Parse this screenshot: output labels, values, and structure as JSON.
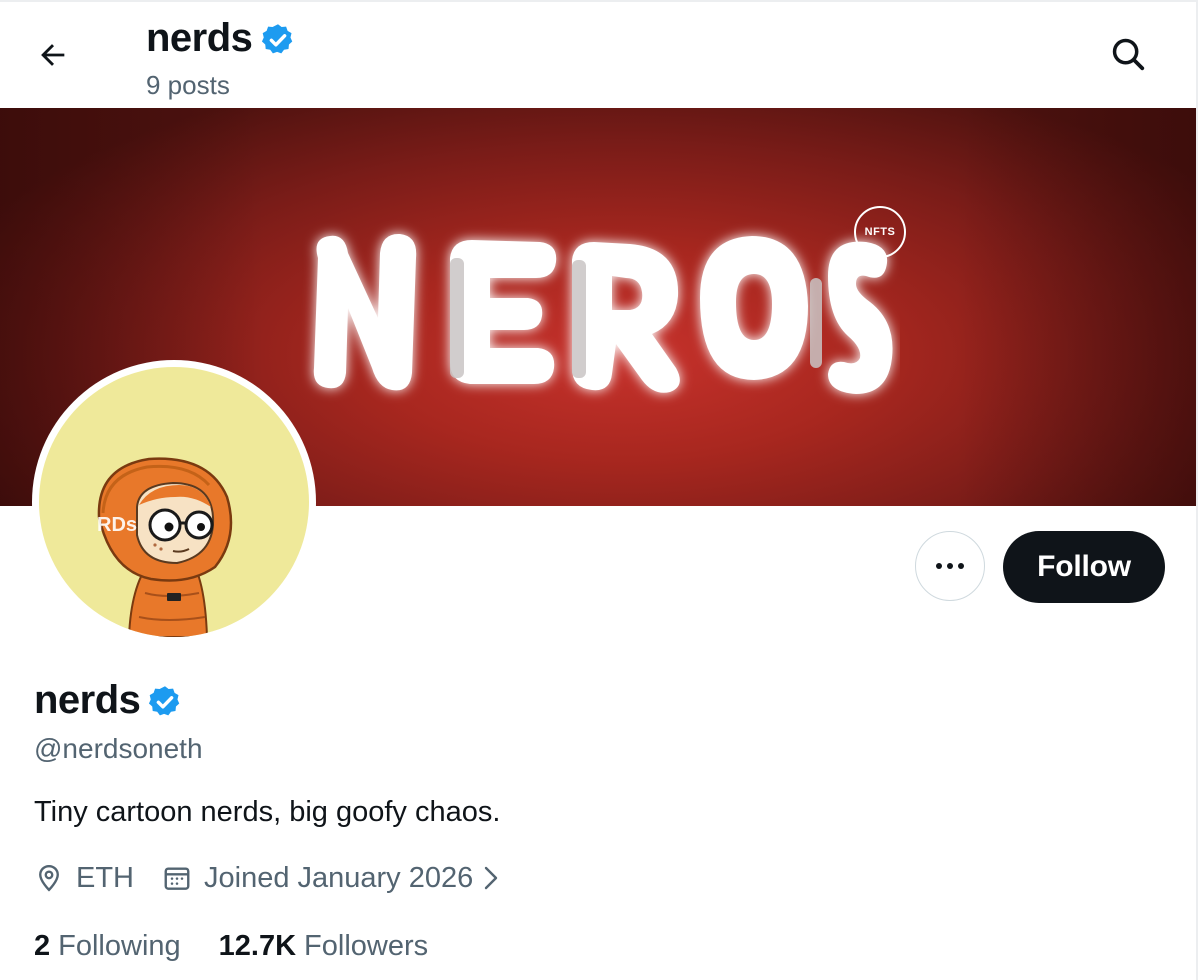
{
  "header": {
    "title": "nerds",
    "posts_count": "9 posts"
  },
  "banner": {
    "logo_text": "NERDS",
    "badge_text": "NFTS"
  },
  "avatar": {
    "hood_text": "RDs"
  },
  "actions": {
    "follow_label": "Follow"
  },
  "profile": {
    "display_name": "nerds",
    "handle": "@nerdsoneth",
    "bio": "Tiny cartoon nerds, big goofy chaos.",
    "location": "ETH",
    "joined": "Joined January 2026"
  },
  "stats": {
    "following_count": "2",
    "following_label": "Following",
    "followers_count": "12.7K",
    "followers_label": "Followers"
  },
  "colors": {
    "verified_blue": "#1d9bf0",
    "follow_button_bg": "#0f1419",
    "secondary_text": "#536471",
    "banner_red": "#b82a22",
    "avatar_bg": "#efe99a",
    "hoodie_orange": "#e8782a"
  },
  "icons": {
    "back": "arrow-left-icon",
    "search": "search-icon",
    "verified": "verified-badge-icon",
    "more": "more-dots-icon",
    "location": "location-pin-icon",
    "calendar": "calendar-icon",
    "chevron": "chevron-right-icon"
  }
}
